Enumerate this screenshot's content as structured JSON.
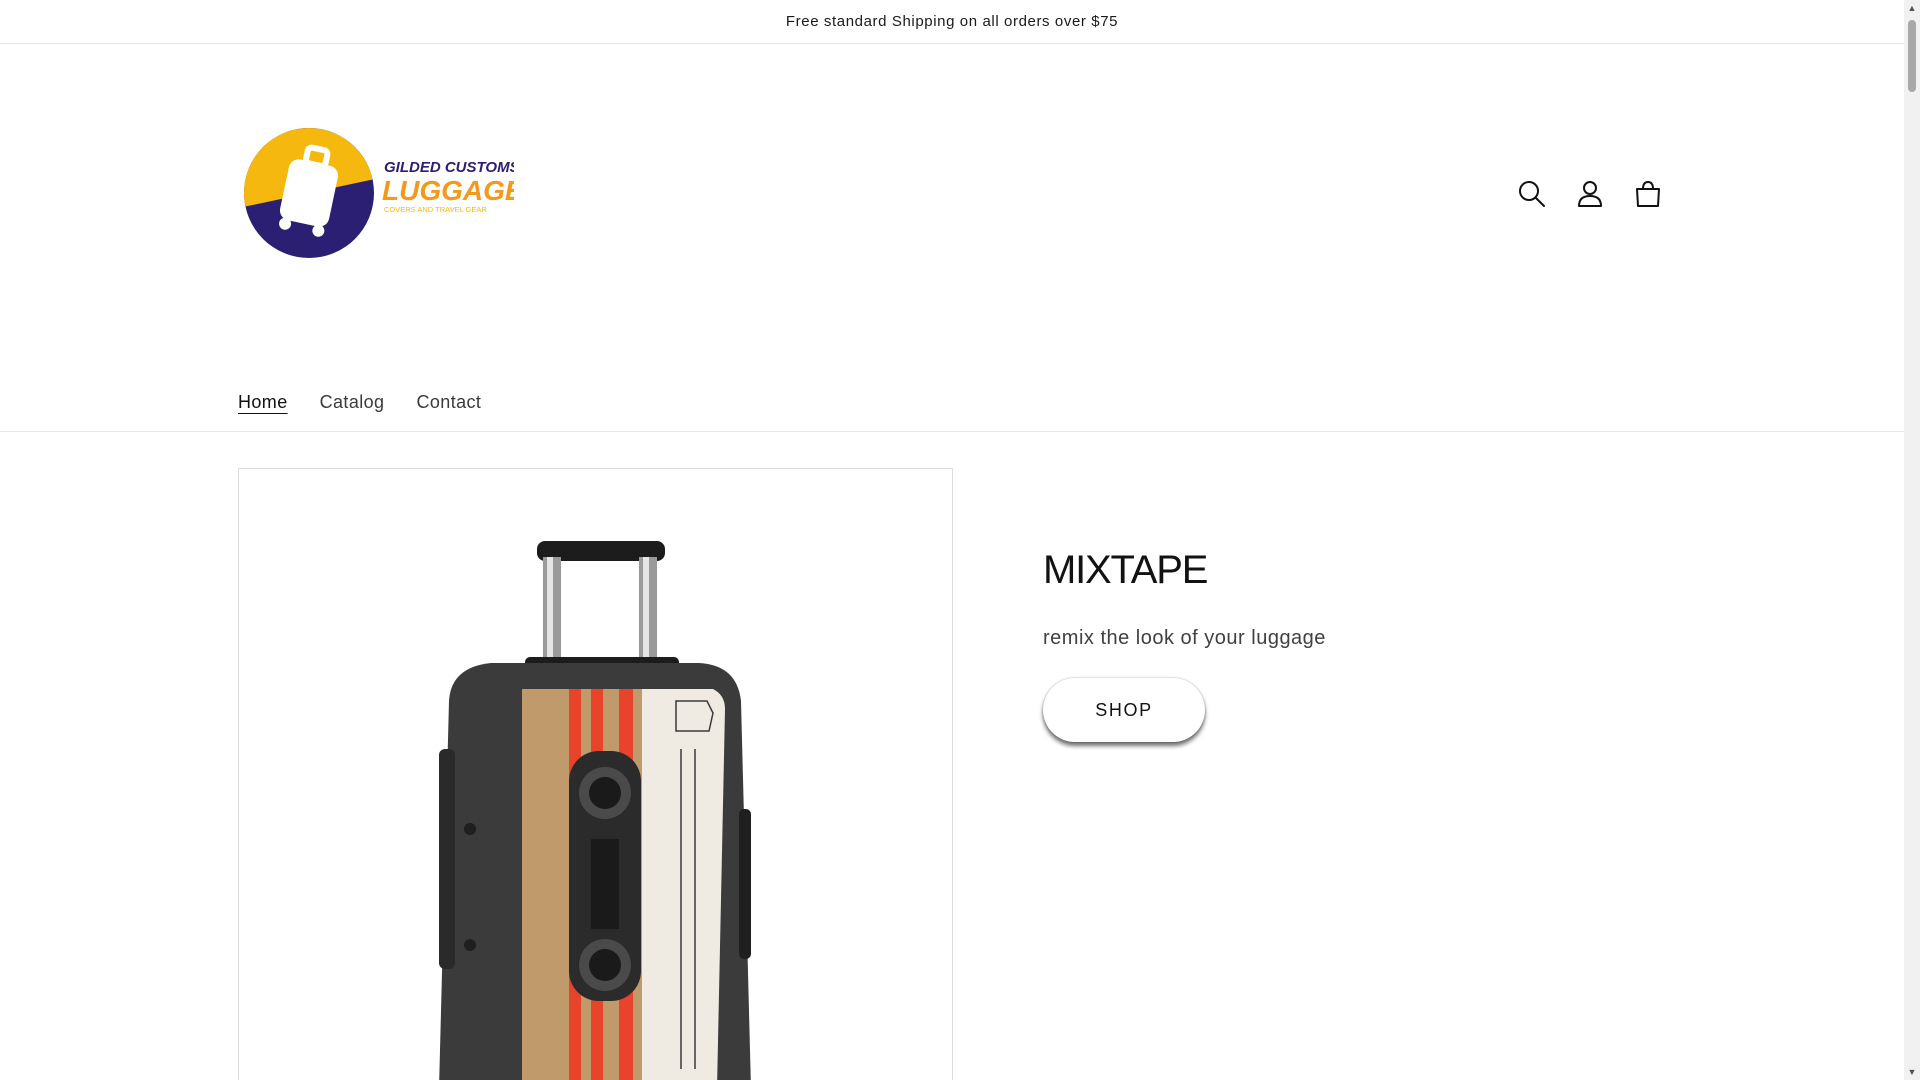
{
  "announcement": {
    "text": "Free standard Shipping on all orders over $75"
  },
  "logo": {
    "line1": "GILDED CUSTOMS",
    "line2": "LUGGAGE",
    "line3": "COVERS AND TRAVEL GEAR",
    "colors": {
      "yellow": "#f5b80f",
      "navy": "#2b1f73",
      "orange": "#f39a1c"
    }
  },
  "header": {
    "icons": [
      "search-icon",
      "account-icon",
      "cart-icon"
    ]
  },
  "nav": {
    "items": [
      {
        "label": "Home",
        "active": true
      },
      {
        "label": "Catalog",
        "active": false
      },
      {
        "label": "Contact",
        "active": false
      }
    ]
  },
  "hero": {
    "title": "MIXTAPE",
    "subtitle": "remix the look of your luggage",
    "button_label": "SHOP"
  },
  "product_image": {
    "icon": "cassette-luggage-cover-image"
  }
}
